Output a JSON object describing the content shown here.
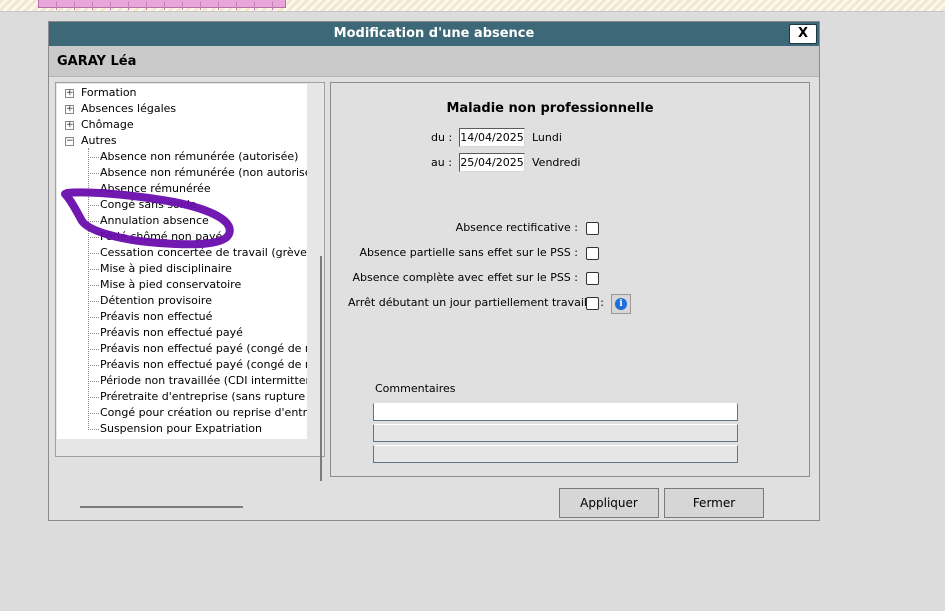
{
  "dialog": {
    "title": "Modification d'une absence",
    "close_label": "X",
    "person_name": "GARAY Léa"
  },
  "tree": {
    "groups": [
      {
        "label": "Formation",
        "expander": "+"
      },
      {
        "label": "Absences légales",
        "expander": "+"
      },
      {
        "label": "Chômage",
        "expander": "+"
      },
      {
        "label": "Autres",
        "expander": "−"
      }
    ],
    "items": [
      "Absence non rémunérée (autorisée)",
      "Absence non rémunérée (non autorisée)",
      "Absence rémunérée",
      "Congé sans solde",
      "Annulation absence",
      "Férié chômé non payé",
      "Cessation concertée de travail (grève)",
      "Mise à pied disciplinaire",
      "Mise à pied conservatoire",
      "Détention provisoire",
      "Préavis non effectué",
      "Préavis non effectué payé",
      "Préavis non effectué payé (congé de reclas",
      "Préavis non effectué payé (congé de mobili",
      "Période non travaillée (CDI intermittent san",
      "Préretraite d'entreprise (sans rupture de co",
      "Congé pour création ou reprise d'entreprise",
      "Suspension pour Expatriation"
    ],
    "annotation_color": "#6a0dad"
  },
  "detail": {
    "absence_type": "Maladie non professionnelle",
    "from_label": "du :",
    "from_date": "14/04/2025",
    "from_day": "Lundi",
    "to_label": "au :",
    "to_date": "25/04/2025",
    "to_day": "Vendredi",
    "checkboxes": [
      {
        "label": "Absence rectificative :",
        "checked": false
      },
      {
        "label": "Absence partielle sans effet sur le PSS :",
        "checked": false
      },
      {
        "label": "Absence complète avec effet sur le PSS :",
        "checked": false
      },
      {
        "label": "Arrêt débutant un jour partiellement travaillé :",
        "checked": false
      }
    ],
    "info_glyph": "i",
    "comments_label": "Commentaires"
  },
  "buttons": {
    "apply": "Appliquer",
    "close": "Fermer"
  }
}
